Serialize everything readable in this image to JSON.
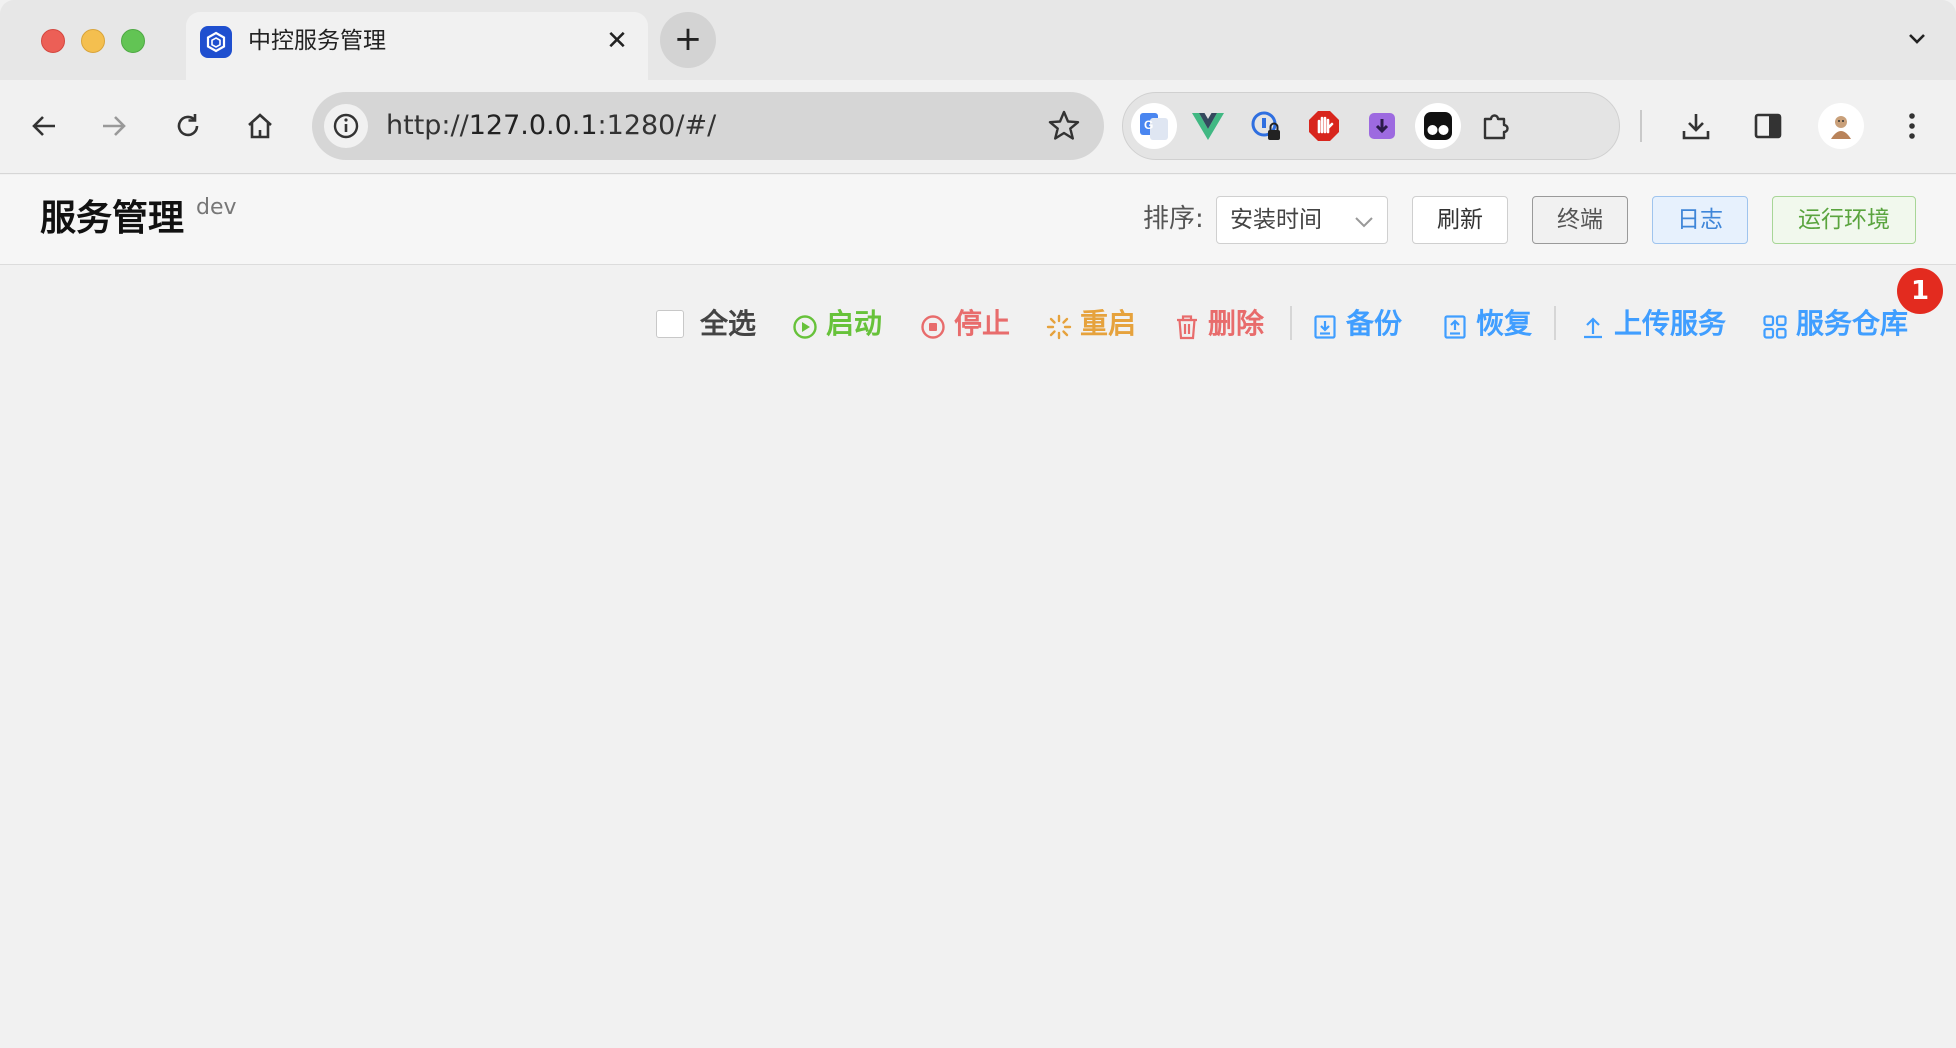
{
  "browser": {
    "tab": {
      "title": "中控服务管理",
      "close_glyph": "✕",
      "favicon": "app-logo-icon"
    },
    "newtab_glyph": "+",
    "url": {
      "scheme": "http://",
      "host": "127.0.0.1",
      "rest": ":1280/#/"
    },
    "extensions": [
      "google-translate-icon",
      "vue-devtools-icon",
      "password-manager-icon",
      "adblock-icon",
      "downloader-extension-icon",
      "tampermonkey-icon",
      "extensions-puzzle-icon"
    ]
  },
  "header": {
    "title": "服务管理",
    "tag": "dev",
    "sort_label": "排序:",
    "sort_value": "安装时间",
    "buttons": {
      "refresh": "刷新",
      "terminal": "终端",
      "logs": "日志",
      "env": "运行环境"
    }
  },
  "actions": {
    "select_all": "全选",
    "start": "启动",
    "stop": "停止",
    "restart": "重启",
    "delete": "删除",
    "backup": "备份",
    "restore": "恢复",
    "upload": "上传服务",
    "repository": "服务仓库",
    "repository_badge": "1"
  },
  "colors": {
    "start": "#67c23a",
    "stop": "#e86c6c",
    "restart": "#e6a23c",
    "delete": "#e86c6c",
    "primary": "#409eff"
  }
}
